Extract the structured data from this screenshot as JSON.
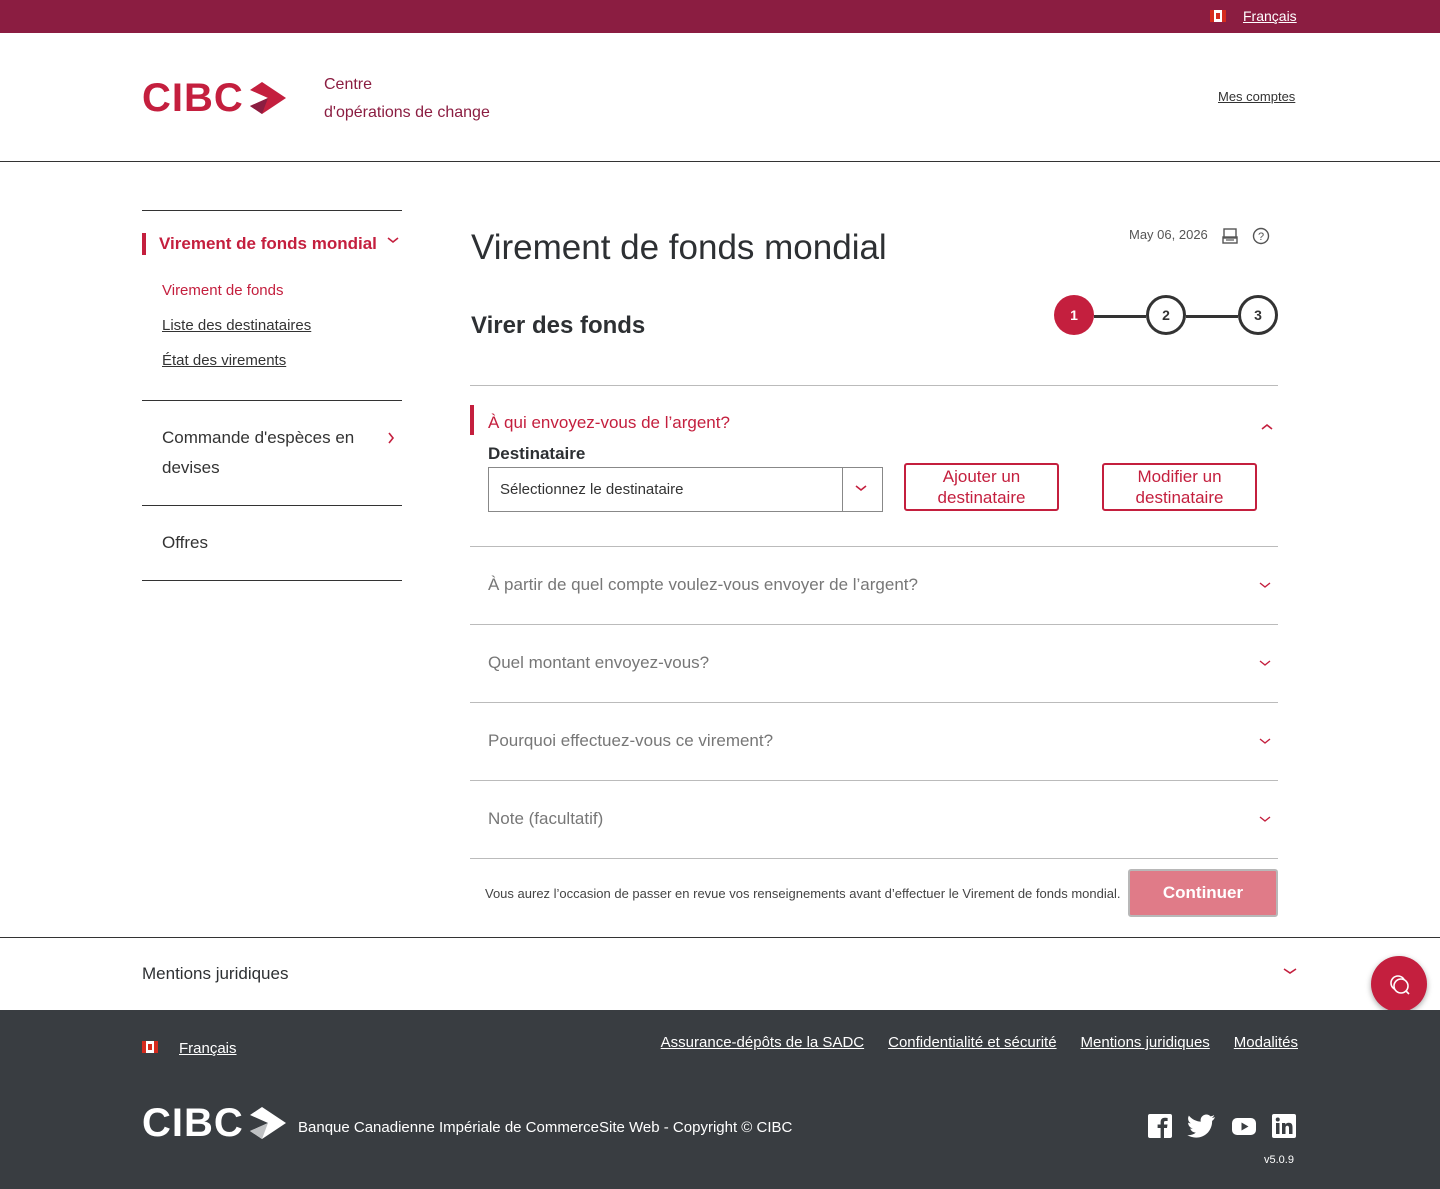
{
  "topbar": {
    "language_link": "Français"
  },
  "header": {
    "logo_text": "CIBC",
    "subtitle_line1": "Centre",
    "subtitle_line2": "d'opérations de change",
    "my_accounts_link": "Mes comptes"
  },
  "sidenav": {
    "active_section": "Virement de fonds mondial",
    "sub_items": [
      {
        "label": "Virement de fonds",
        "current": true
      },
      {
        "label": "Liste des destinataires",
        "current": false
      },
      {
        "label": "État des virements",
        "current": false
      }
    ],
    "items": [
      {
        "label": "Commande d'espèces en devises"
      },
      {
        "label": "Offres"
      }
    ]
  },
  "main": {
    "page_title": "Virement de fonds mondial",
    "date": "May 06, 2026",
    "section_title": "Virer des fonds",
    "steps": [
      "1",
      "2",
      "3"
    ],
    "current_step": 1,
    "recipient_section": {
      "question": "À qui envoyez-vous de l’argent?",
      "field_label": "Destinataire",
      "select_value": "Sélectionnez le destinataire",
      "add_button": "Ajouter un destinataire",
      "edit_button": "Modifier un destinataire"
    },
    "collapsed_sections": [
      "À partir de quel compte voulez-vous envoyer de l’argent?",
      "Quel montant envoyez-vous?",
      "Pourquoi effectuez-vous ce virement?",
      "Note (facultatif)"
    ],
    "review_note": "Vous aurez l’occasion de passer en revue vos renseignements avant d’effectuer le Virement de fonds mondial.",
    "continue_button": "Continuer"
  },
  "legal": {
    "label": "Mentions juridiques"
  },
  "footer": {
    "language_link": "Français",
    "links": [
      "Assurance-dépôts de la SADC",
      "Confidentialité et sécurité",
      "Mentions juridiques",
      "Modalités"
    ],
    "logo_text": "CIBC",
    "copyright": "Banque Canadienne Impériale de CommerceSite Web - Copyright © CIBC",
    "social_icons": [
      "facebook-icon",
      "twitter-icon",
      "youtube-icon",
      "linkedin-icon"
    ],
    "version": "v5.0.9"
  },
  "colors": {
    "brand_red": "#c41f3e",
    "topbar_burgundy": "#8b1d41",
    "footer_dark": "#393d41",
    "disabled_button": "#e07b88"
  }
}
